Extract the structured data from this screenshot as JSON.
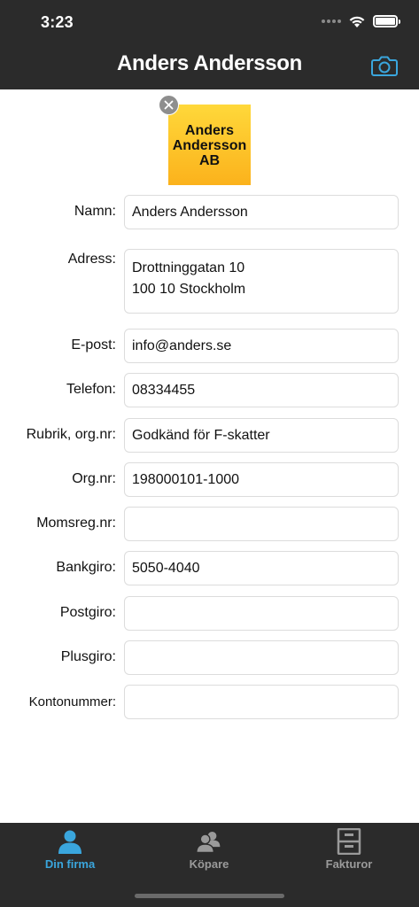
{
  "status_bar": {
    "time": "3:23"
  },
  "nav": {
    "title": "Anders Andersson"
  },
  "logo": {
    "lines": [
      "Anders",
      "Andersson",
      "AB"
    ],
    "gradient_top": "#ffd83a",
    "gradient_bottom": "#fbb21c"
  },
  "form": {
    "fields": [
      {
        "label": "Namn:",
        "value": "Anders Andersson"
      },
      {
        "label": "Adress:",
        "value_lines": [
          "Drottninggatan 10",
          "100 10 Stockholm"
        ]
      },
      {
        "label": "E-post:",
        "value": "info@anders.se"
      },
      {
        "label": "Telefon:",
        "value": "08334455"
      },
      {
        "label": "Rubrik, org.nr:",
        "value": "Godkänd för F-skatter"
      },
      {
        "label": "Org.nr:",
        "value": "198000101-1000"
      },
      {
        "label": "Momsreg.nr:",
        "value": ""
      },
      {
        "label": "Bankgiro:",
        "value": "5050-4040"
      },
      {
        "label": "Postgiro:",
        "value": ""
      },
      {
        "label": "Plusgiro:",
        "value": ""
      },
      {
        "label": "Kontonummer:",
        "value": ""
      }
    ]
  },
  "tabs": [
    {
      "label": "Din firma",
      "icon": "person-icon",
      "active": true
    },
    {
      "label": "Köpare",
      "icon": "people-icon",
      "active": false
    },
    {
      "label": "Fakturor",
      "icon": "cabinet-icon",
      "active": false
    }
  ],
  "colors": {
    "bar": "#2b2b2b",
    "accent": "#3aa6dd",
    "inactive": "#9a9a9a"
  }
}
